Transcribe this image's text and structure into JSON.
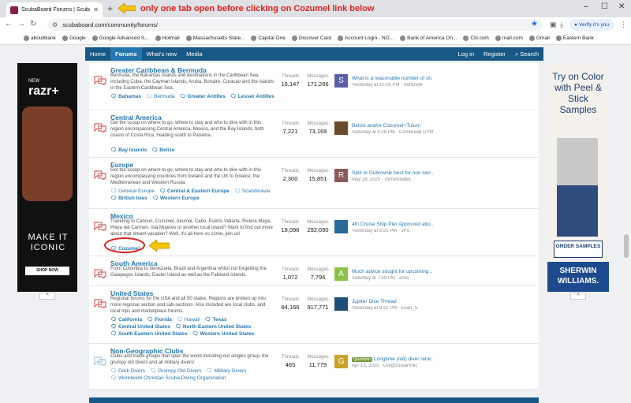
{
  "browser": {
    "tab_title": "ScubaBoard Forums | ScubaBoard",
    "new_tab": "+",
    "annotation_top": "only one tab open before clicking on Cozumel link below",
    "url": "scubaboard.com/community/forums/",
    "verify_label": "Verify it's you",
    "window_controls": [
      "–",
      "☐",
      "✕"
    ]
  },
  "bookmarks": [
    "aboutblank",
    "Google",
    "Google Advanced S...",
    "Hotmail",
    "Massachusetts State...",
    "Capital One",
    "Discover Card",
    "Account Login - NO...",
    "Bank of America On...",
    "Citi.com",
    "mail.com",
    "Gmail",
    "Eastern Bank"
  ],
  "forum_nav": {
    "left": [
      "Home",
      "Forums",
      "What's new",
      "Media"
    ],
    "right": [
      "Log in",
      "Register",
      "Search"
    ]
  },
  "ad_left": {
    "brand": "motorola",
    "product": "razr+",
    "tag": "NEW",
    "headline": "MAKE IT ICONIC",
    "cta": "SHOP NOW"
  },
  "ad_right": {
    "headline": "Try on Color with Peel & Stick Samples",
    "cta": "ORDER SAMPLES",
    "brand": "SHERWIN WILLIAMS."
  },
  "stat_labels": {
    "threads": "Threads",
    "messages": "Messages"
  },
  "forums": [
    {
      "title": "Greater Caribbean & Bermuda",
      "desc": "Bermuda, the Bahamas Islands and destinations in the Caribbean Sea, including Cuba, the Cayman Islands, Aruba, Bonaire, Curacao and the islands in the Eastern Caribbean Sea.",
      "subforums": [
        {
          "name": "Bahamas",
          "unread": true
        },
        {
          "name": "Bermuda",
          "unread": false
        },
        {
          "name": "Greater Antilles",
          "unread": true
        },
        {
          "name": "Lesser Antilles",
          "unread": true
        }
      ],
      "threads": "16,147",
      "messages": "171,266",
      "avatar": "S",
      "avatar_color": "#5c5fa8",
      "last_title": "What is a reasonable number of sh...",
      "last_meta": "Yesterday at 10:06 PM · SeltDiver",
      "badge": ""
    },
    {
      "title": "Central America",
      "desc": "Get the scoop on where to go, where to stay and who to dive with in this region encompassing Central America, Mexico, and the Bay Islands, both coasts of Costa Rica, heading south to Panama.",
      "subforums": [
        {
          "name": "Bay Islands",
          "unread": true
        },
        {
          "name": "Belize",
          "unread": true
        }
      ],
      "threads": "7,221",
      "messages": "73,169",
      "avatar": "",
      "avatar_color": "#6b4a2a",
      "last_title": "Belize and/or Cozumel+Tulum",
      "last_meta": "Saturday at 4:28 PM · Cornbread DYM",
      "badge": ""
    },
    {
      "title": "Europe",
      "desc": "Get the scoop on where to go, where to stay and who to dive with in this region encompassing countries from Iceland and the UK to Greece, the Mediterranean and Western Russia.",
      "subforums": [
        {
          "name": "General Europe",
          "unread": false
        },
        {
          "name": "Central & Eastern Europe",
          "unread": true
        },
        {
          "name": "Scandinavia",
          "unread": false
        },
        {
          "name": "British Isles",
          "unread": true
        },
        {
          "name": "Western Europe",
          "unread": true
        }
      ],
      "threads": "2,300",
      "messages": "15,851",
      "avatar": "R",
      "avatar_color": "#8a5a5a",
      "last_title": "Split or Dubrovnik best for non cen...",
      "last_meta": "May 29, 2025 · rochelclabec",
      "badge": ""
    },
    {
      "title": "Mexico",
      "desc": "Traveling to Cancun, Cozumel, Akumal, Cabo, Puerto Vallarta, Riviera Maya, Playa del Carmen, Isla Mujeres or another local island? Want to find out more about that dream vacation? Well, it's all here so come, join us!",
      "subforums": [
        {
          "name": "Cozumel",
          "unread": true
        }
      ],
      "threads": "18,096",
      "messages": "292,090",
      "avatar": "",
      "avatar_color": "#2a6a9a",
      "last_title": "4th Cruise Ship Pier Approved abo...",
      "last_meta": "Yesterday at 9:25 PM · JPS",
      "badge": ""
    },
    {
      "title": "South America",
      "desc": "From Colombia to Venezuela, Brazil and Argentina whilst not forgetting the Galapagos Islands, Easter Island as well as the Falkland Islands.",
      "subforums": [],
      "threads": "1,072",
      "messages": "7,796",
      "avatar": "A",
      "avatar_color": "#8bc34a",
      "last_title": "Much advice sought for upcoming ...",
      "last_meta": "Saturday at 7:49 PM · ardo",
      "badge": ""
    },
    {
      "title": "United States",
      "desc": "Regional forums for the USA and all 50 states. Regions are broken up into more regional section and sub-sections. Also included are local clubs, and local trips and marketplace forums.",
      "subforums": [
        {
          "name": "California",
          "unread": true
        },
        {
          "name": "Florida",
          "unread": true
        },
        {
          "name": "Hawaii",
          "unread": false
        },
        {
          "name": "Texas",
          "unread": true
        },
        {
          "name": "Central United States",
          "unread": true
        },
        {
          "name": "North Eastern United States",
          "unread": true
        },
        {
          "name": "South Eastern United States",
          "unread": true
        },
        {
          "name": "Western United States",
          "unread": true
        }
      ],
      "threads": "84,166",
      "messages": "917,771",
      "avatar": "",
      "avatar_color": "#1f4e7a",
      "last_title": "Jupiter Dive Thread",
      "last_meta": "Yesterday at 9:32 PM · Evan_S",
      "badge": ""
    },
    {
      "title": "Non-Geographic Clubs",
      "desc": "Clubs and travel groups that span the world including our singles group, the grumpy old divers and all military divers!",
      "subforums": [
        {
          "name": "Dork Divers",
          "unread": false
        },
        {
          "name": "Grumpy Old Divers",
          "unread": false
        },
        {
          "name": "Military Divers",
          "unread": false
        },
        {
          "name": "Worldwide Christian Scuba Diving Organization",
          "unread": false
        }
      ],
      "threads": "465",
      "messages": "11,779",
      "avatar": "G",
      "avatar_color": "#c9a227",
      "last_title": "Longtime (old) diver reloc...",
      "last_meta": "Apr 13, 2025 · GregScubaHolic",
      "badge": "Question"
    }
  ]
}
